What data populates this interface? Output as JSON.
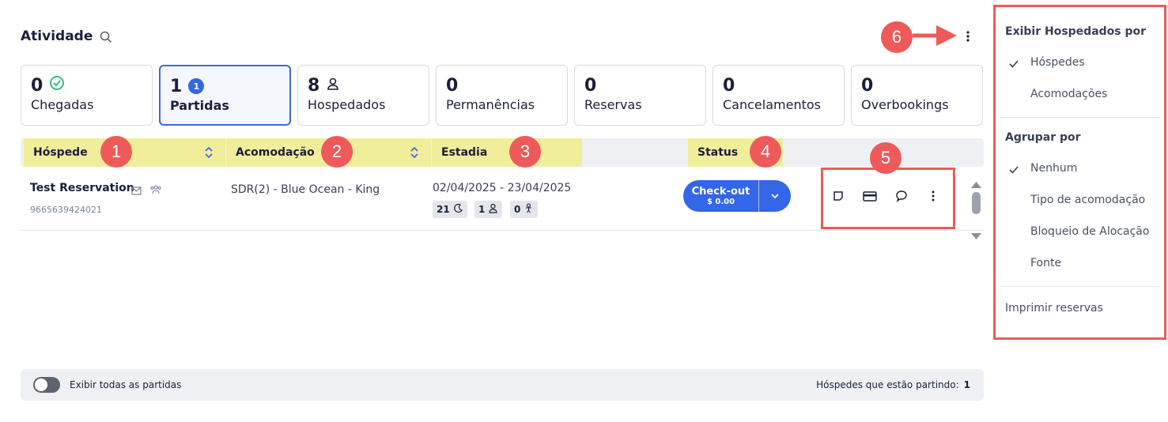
{
  "header": {
    "title": "Atividade"
  },
  "cards": [
    {
      "value": "0",
      "label": "Chegadas"
    },
    {
      "value": "1",
      "badge": "1",
      "label": "Partidas"
    },
    {
      "value": "8",
      "label": "Hospedados"
    },
    {
      "value": "0",
      "label": "Permanências"
    },
    {
      "value": "0",
      "label": "Reservas"
    },
    {
      "value": "0",
      "label": "Cancelamentos"
    },
    {
      "value": "0",
      "label": "Overbookings"
    }
  ],
  "table": {
    "columns": [
      "Hóspede",
      "Acomodação",
      "Estadia",
      "Status"
    ],
    "row": {
      "guest": "Test Reservation",
      "guest_id": "9665639424021",
      "room": "SDR(2) - Blue Ocean - King",
      "dates": "02/04/2025 - 23/04/2025",
      "nights": "21",
      "adults": "1",
      "children": "0",
      "action_label": "Check-out",
      "action_amount": "$ 0.00"
    }
  },
  "footer": {
    "toggle_label": "Exibir todas as partidas",
    "summary_label": "Hóspedes que estão partindo:",
    "summary_value": "1"
  },
  "annotations": [
    "1",
    "2",
    "3",
    "4",
    "5",
    "6"
  ],
  "menu": {
    "section1": "Exibir Hospedados por",
    "s1_items": [
      "Hóspedes",
      "Acomodações"
    ],
    "section2": "Agrupar por",
    "s2_items": [
      "Nenhum",
      "Tipo de acomodação",
      "Bloqueio de Alocação",
      "Fonte"
    ],
    "print": "Imprimir reservas"
  },
  "colors": {
    "accent": "#3366e8",
    "annotation": "#ee5a5a",
    "highlight": "#f0ee9a"
  }
}
